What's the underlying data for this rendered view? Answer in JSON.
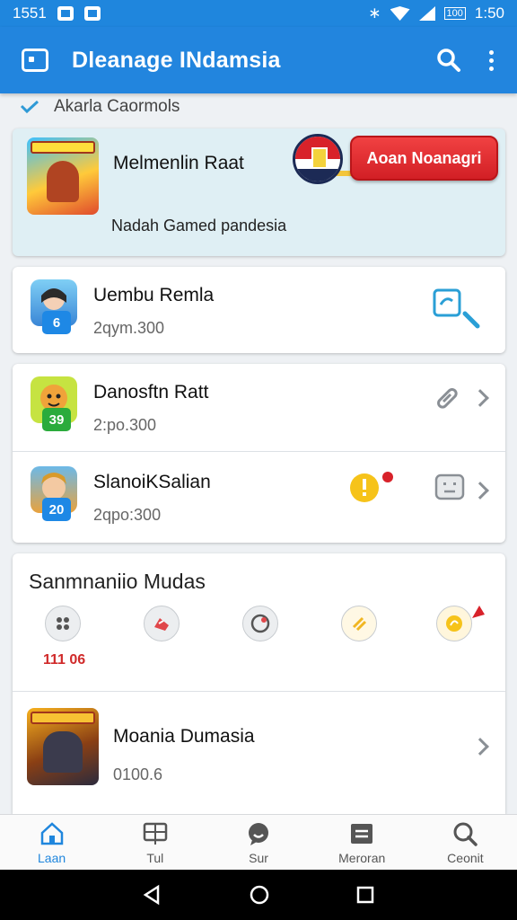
{
  "status_bar": {
    "time_left": "1551",
    "time_right": "1:50",
    "battery": "100"
  },
  "app_bar": {
    "title": "Dleanage INdamsia"
  },
  "section": {
    "label": "Akarla Caormols"
  },
  "featured": {
    "name": "Melmenlin Raat",
    "description": "Nadah Gamed pandesia",
    "promo_button": "Aoan Noanagri"
  },
  "list": [
    {
      "name": "Uembu Remla",
      "meta": "2qym.300",
      "rank": "6",
      "rank_color": "#1e88e5"
    },
    {
      "name": "Danosftn Ratt",
      "meta": "2:po.300",
      "rank": "39",
      "rank_color": "#2bab3c"
    },
    {
      "name": "SlanoiKSalian",
      "meta": "2qpo:300",
      "rank": "20",
      "rank_color": "#1e88e5"
    }
  ],
  "mudas": {
    "title": "Sanmnaniio Mudas",
    "counter": "111 06",
    "icons": [
      "gamepad-icon",
      "shoe-icon",
      "chat-bubble-icon",
      "slash-icon",
      "coin-icon"
    ]
  },
  "bottom_game": {
    "name": "Moania Dumasia",
    "meta": "0100.6"
  },
  "bottom_nav": [
    {
      "label": "Laan",
      "icon": "home-icon"
    },
    {
      "label": "Tul",
      "icon": "grid-icon"
    },
    {
      "label": "Sur",
      "icon": "chat-icon"
    },
    {
      "label": "Meroran",
      "icon": "list-icon"
    },
    {
      "label": "Ceonit",
      "icon": "search-icon"
    }
  ],
  "colors": {
    "primary": "#2285de",
    "accent_red": "#d21f25",
    "active_nav": "#1f86dd"
  }
}
